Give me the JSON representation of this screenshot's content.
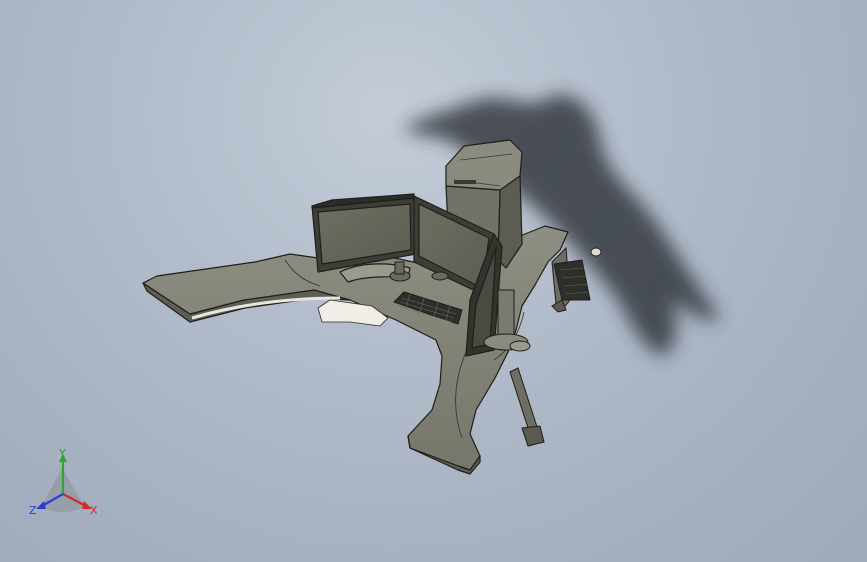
{
  "viewport": {
    "background_top": "#c3ccd8",
    "background_bottom": "#9ea9b9"
  },
  "model": {
    "body_color": "#7e7e72",
    "top_color": "#8c8c80",
    "edge_color": "#1e1e1a",
    "shadow_color": "#2a2e34",
    "highlight_color": "#e8e6dc"
  },
  "triad": {
    "y_label": "Y",
    "x_label": "X",
    "z_label": "Z",
    "y_color": "#2aa82a",
    "x_color": "#d42a2a",
    "z_color": "#2a3ed4"
  }
}
